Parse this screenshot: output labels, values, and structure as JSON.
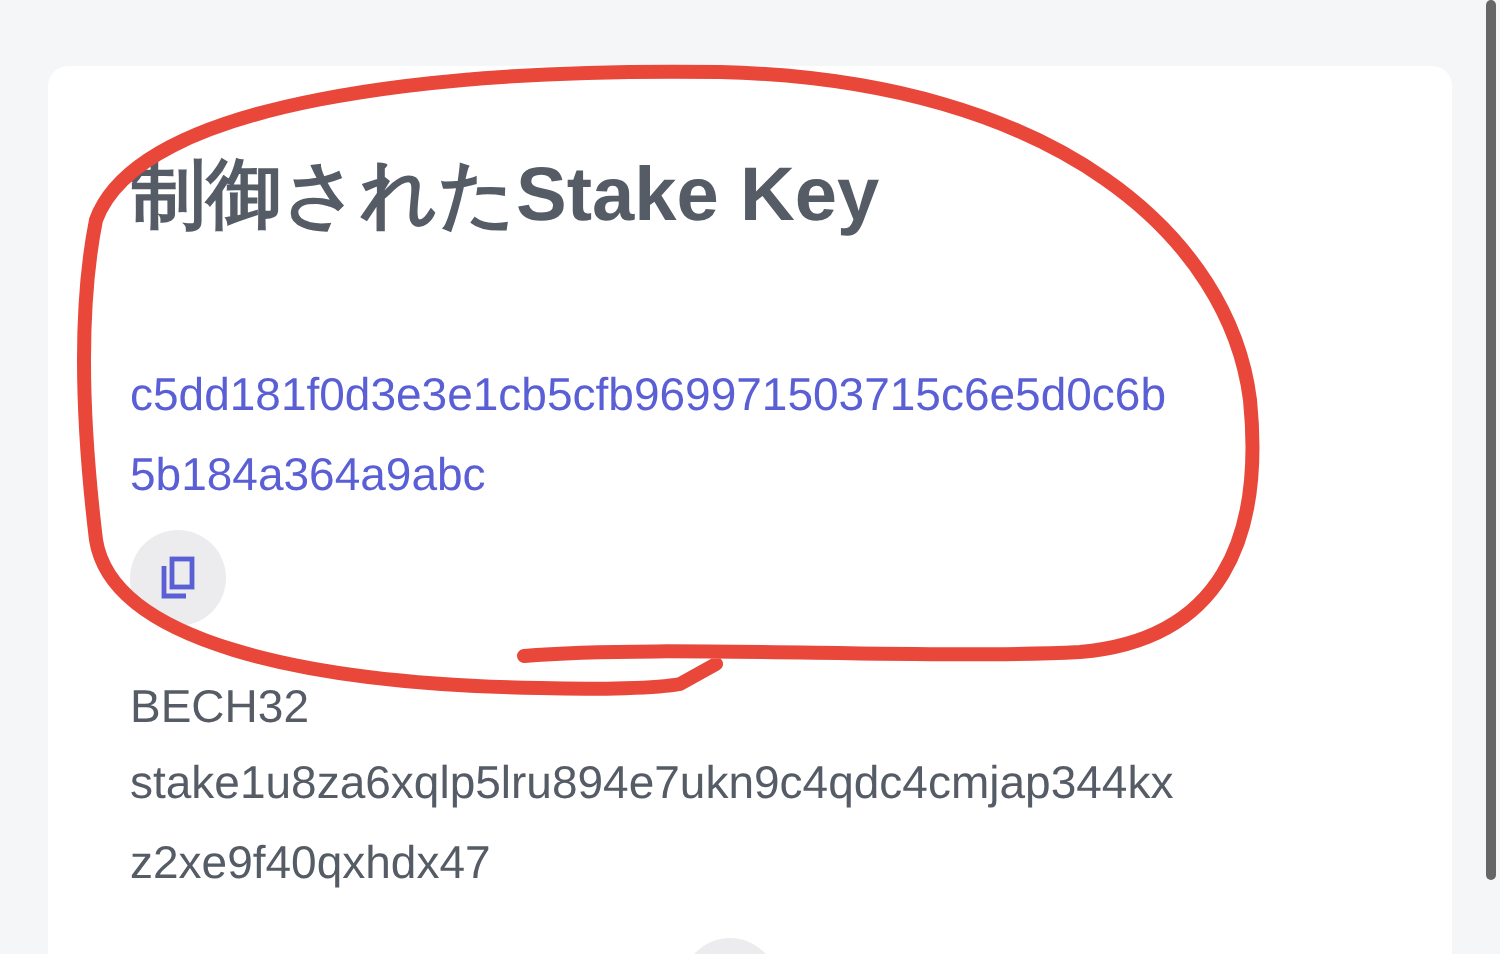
{
  "card": {
    "title": "制御されたStake Key",
    "key_hex": "c5dd181f0d3e3e1cb5cfb969971503715c6e5d0c6b5b184a364a9abc",
    "bech32_label": "BECH32",
    "bech32_value": "stake1u8za6xqlp5lru894e7ukn9c4qdc4cmjap344kxz2xe9f40qxhdx47"
  }
}
